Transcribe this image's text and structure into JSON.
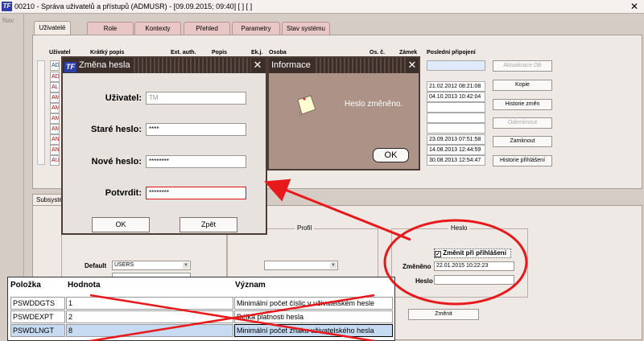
{
  "window": {
    "title": "00210 - Správa uživatelů a přístupů (ADMUSR) - [09.09.2015; 09:40]  [ ]  [ ]",
    "logo": "TF",
    "close": "✕"
  },
  "nav": {
    "label": "Nav"
  },
  "tabs": [
    "Uživatelé",
    "Role",
    "Kontexty",
    "Přehled",
    "Parametry",
    "Stav systému"
  ],
  "user_table": {
    "headers": [
      "Uživatel",
      "Krátký popis",
      "Ext. auth.",
      "Popis",
      "Ek.j.",
      "Osoba",
      "Os. č.",
      "Zámek",
      "Poslední připojení"
    ],
    "rows": [
      "AD",
      "AD",
      "AL",
      "AM",
      "AM",
      "AM",
      "AM",
      "AN",
      "AN",
      "AU"
    ],
    "last_login": [
      "",
      "21.02.2012 08:21:08",
      "04.10.2013 10:42:04",
      "",
      "",
      "",
      "23.09.2013 07:51:58",
      "14.08.2013 12:44:59",
      "30.08.2013 12:54:47"
    ]
  },
  "side_buttons": {
    "refresh_db": "Aktualizace DB",
    "copy": "Kopie",
    "change_history": "Historie změn",
    "unlock": "Odemknout",
    "lock": "Zamknout",
    "login_history": "Historie přihlášení"
  },
  "lower": {
    "subtab": "Subsystémy",
    "profile_title": "Profil",
    "default_label": "Default",
    "default_value": "USERS",
    "password_group": {
      "title": "Heslo",
      "change_on_login": "Změnit při přihlášení",
      "changed_label": "Změněno",
      "changed_value": "22.01.2015 10:22:23",
      "password_label": "Heslo",
      "change_button": "Změnit"
    }
  },
  "change_password_dialog": {
    "title": "Změna hesla",
    "user_label": "Uživatel:",
    "user_value": "TM",
    "old_label": "Staré heslo:",
    "old_value": "****",
    "new_label": "Nové heslo:",
    "new_value": "********",
    "confirm_label": "Potvrdit:",
    "confirm_value": "********",
    "ok": "OK",
    "back": "Zpět"
  },
  "info_dialog": {
    "title": "Informace",
    "message": "Heslo změněno.",
    "ok": "OK"
  },
  "param_table": {
    "headers": [
      "Položka",
      "Hodnota",
      "Význam"
    ],
    "rows": [
      {
        "item": "PSWDDGTS",
        "value": "1",
        "meaning": "Minimální počet číslic v uživatelském hesle"
      },
      {
        "item": "PSWDEXPT",
        "value": "2",
        "meaning": "Délka platnosti hesla"
      },
      {
        "item": "PSWDLNGT",
        "value": "8",
        "meaning": "Minimální počet znaku uživatelského hesla"
      }
    ]
  },
  "colors": {
    "annotation_red": "#e8191b",
    "dialog_title": "#3c2e28",
    "info_bg": "#ad9287",
    "highlight_row": "#c6dbf2"
  },
  "icons": [
    "tf-logo-icon",
    "close-icon",
    "note-icon",
    "dropdown-arrow-icon",
    "checkbox-icon"
  ]
}
